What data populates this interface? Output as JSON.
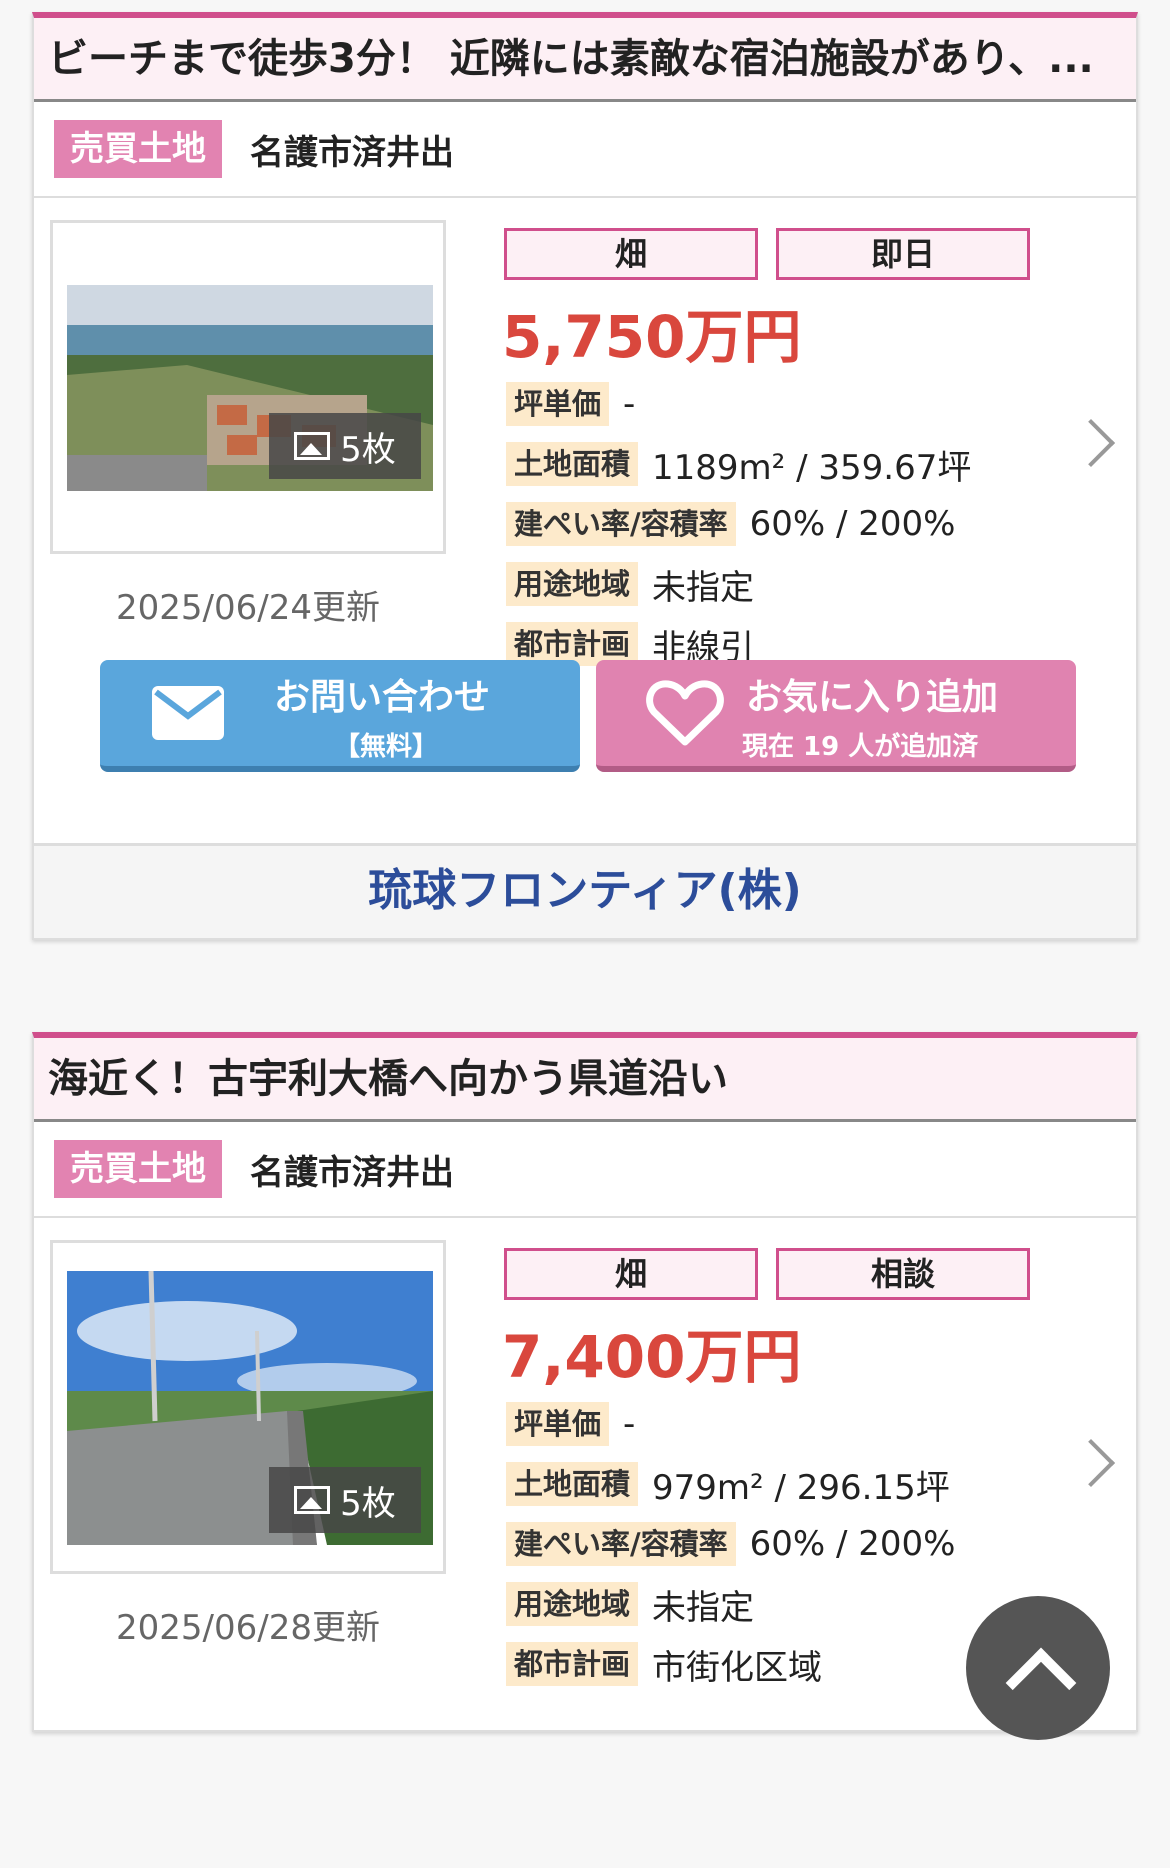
{
  "listings": [
    {
      "title": "ビーチまで徒歩3分！ 近隣には素敵な宿泊施設があり、...",
      "type": "売買土地",
      "location": "名護市済井出",
      "photo_count": "5枚",
      "updated": "2025/06/24更新",
      "tags": [
        "畑",
        "即日"
      ],
      "price": "5,750万円",
      "specs": [
        {
          "label": "坪単価",
          "value": "-"
        },
        {
          "label": "土地面積",
          "value": "1189m² / 359.67坪"
        },
        {
          "label": "建ぺい率/容積率",
          "value": "60% / 200%"
        },
        {
          "label": "用途地域",
          "value": "未指定"
        },
        {
          "label": "都市計画",
          "value": "非線引"
        }
      ],
      "contact_label": "お問い合わせ",
      "contact_sub": "【無料】",
      "fav_label": "お気に入り追加",
      "fav_sub": "現在 19 人が追加済",
      "company": "琉球フロンティア(株)"
    },
    {
      "title": "海近く！古宇利大橋へ向かう県道沿い",
      "type": "売買土地",
      "location": "名護市済井出",
      "photo_count": "5枚",
      "updated": "2025/06/28更新",
      "tags": [
        "畑",
        "相談"
      ],
      "price": "7,400万円",
      "specs": [
        {
          "label": "坪単価",
          "value": "-"
        },
        {
          "label": "土地面積",
          "value": "979m² / 296.15坪"
        },
        {
          "label": "建ぺい率/容積率",
          "value": "60% / 200%"
        },
        {
          "label": "用途地域",
          "value": "未指定"
        },
        {
          "label": "都市計画",
          "value": "市街化区域"
        }
      ]
    }
  ],
  "colors": {
    "accent": "#d04f8c",
    "price": "#d9473d",
    "contact": "#5aa6dc",
    "favorite": "#e083b0",
    "company": "#2c4d9a"
  }
}
